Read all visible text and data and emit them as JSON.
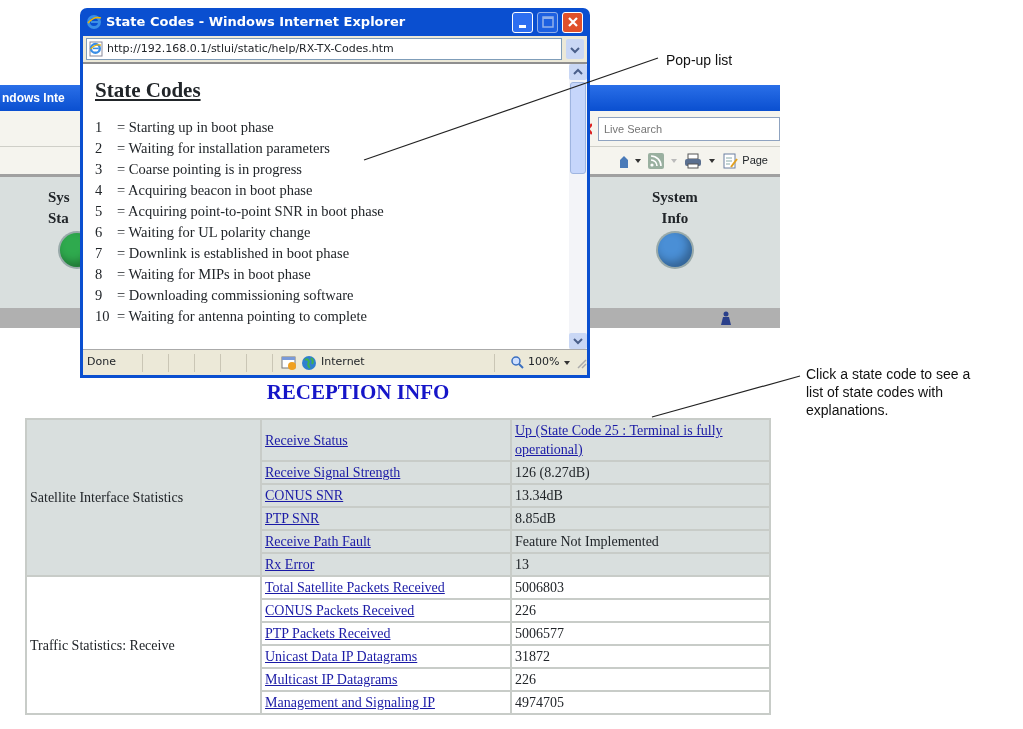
{
  "background_window": {
    "title": "ndows Inte",
    "search": {
      "placeholder": "Live Search"
    },
    "page_menu": "Page",
    "nav_items": [
      {
        "lines": [
          "Sys",
          "Sta"
        ],
        "color": "#2faa4e"
      },
      {
        "lines": [
          "System",
          "Info"
        ],
        "color": "#4a8fd6"
      }
    ]
  },
  "page": {
    "heading": "RECEPTION INFO",
    "groups": [
      {
        "label": "Satellite Interface Statistics",
        "shaded": true,
        "rows": [
          {
            "name": "Receive Status",
            "value": "Up (State Code 25 : Terminal is fully operational)",
            "value_is_link": true
          },
          {
            "name": "Receive Signal Strength",
            "value": "126 (8.27dB)",
            "value_is_link": false
          },
          {
            "name": "CONUS SNR",
            "value": "13.34dB",
            "value_is_link": false
          },
          {
            "name": "PTP SNR",
            "value": "8.85dB",
            "value_is_link": false
          },
          {
            "name": "Receive Path Fault",
            "value": "Feature Not Implemented",
            "value_is_link": false
          },
          {
            "name": "Rx Error",
            "value": "13",
            "value_is_link": false
          }
        ]
      },
      {
        "label": "Traffic Statistics: Receive",
        "shaded": false,
        "rows": [
          {
            "name": "Total Satellite Packets Received",
            "value": "5006803",
            "value_is_link": false
          },
          {
            "name": "CONUS Packets Received",
            "value": "226",
            "value_is_link": false
          },
          {
            "name": "PTP Packets Received",
            "value": "5006577",
            "value_is_link": false
          },
          {
            "name": "Unicast Data IP Datagrams",
            "value": "31872",
            "value_is_link": false
          },
          {
            "name": "Multicast IP Datagrams",
            "value": "226",
            "value_is_link": false
          },
          {
            "name": "Management and Signaling IP",
            "value": "4974705",
            "value_is_link": false
          }
        ]
      }
    ]
  },
  "popup": {
    "title": "State Codes - Windows Internet Explorer",
    "address": "http://192.168.0.1/stlui/static/help/RX-TX-Codes.htm",
    "heading": "State Codes",
    "codes": [
      {
        "code": "1",
        "text": "= Starting up in boot phase"
      },
      {
        "code": "2",
        "text": "= Waiting for installation parameters"
      },
      {
        "code": "3",
        "text": "= Coarse pointing is in progress"
      },
      {
        "code": "4",
        "text": "= Acquiring beacon in boot phase"
      },
      {
        "code": "5",
        "text": "= Acquiring point-to-point SNR in boot phase"
      },
      {
        "code": "6",
        "text": "= Waiting for UL polarity change"
      },
      {
        "code": "7",
        "text": "= Downlink is established in boot phase"
      },
      {
        "code": "8",
        "text": "= Waiting for MIPs in boot phase"
      },
      {
        "code": "9",
        "text": "= Downloading commissioning software"
      },
      {
        "code": "10",
        "text": "= Waiting for antenna pointing to complete"
      }
    ],
    "status_bar": {
      "status": "Done",
      "zone": "Internet",
      "zoom": "100%"
    }
  },
  "annotations": [
    {
      "text": "Pop-up list"
    },
    {
      "text": "Click a state code to see a list of state codes with explanations."
    }
  ]
}
